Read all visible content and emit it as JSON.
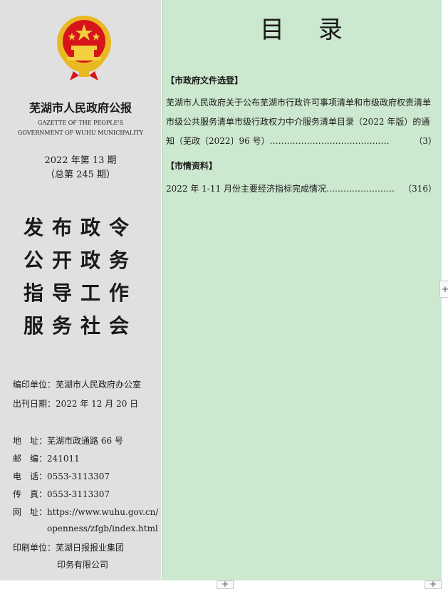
{
  "cover": {
    "title_cn": "芜湖市人民政府公报",
    "title_en_line1": "GAZETTE OF THE PEOPLE'S",
    "title_en_line2": "GOVERNMENT OF WUHU MUNICIPALITY",
    "issue_line1": "2022 年第 13 期",
    "issue_line2": "（总第 245 期）",
    "slogan": [
      "发布政令",
      "公开政务",
      "指导工作",
      "服务社会"
    ],
    "info": {
      "editor": "编印单位：芜湖市人民政府办公室",
      "date": "出刊日期：2022 年 12 月 20 日",
      "address": "地　址：芜湖市政通路 66 号",
      "postcode": "邮　编：241011",
      "tel": "电　话：0553-3113307",
      "fax": "传　真：0553-3113307",
      "web": "网　址：https://www.wuhu.gov.cn/",
      "web2": "openness/zfgb/index.html",
      "printer": "印刷单位：芜湖日报报业集团",
      "printer2": "印务有限公司"
    }
  },
  "toc": {
    "title": "目录",
    "sections": [
      {
        "heading": "【市政府文件选登】",
        "entry_text": "芜湖市人民政府关于公布芜湖市行政许可事项清单和市级政府权责清单市级公共服务清单市级行政权力中介服务清单目录（2022 年版）的通知（芜政〔2022〕96 号）……………………………………",
        "page": "（3）"
      },
      {
        "heading": "【市情资料】",
        "entry_text": "2022 年 1-11 月份主要经济指标完成情况……………………",
        "page": "（316）"
      }
    ]
  },
  "colors": {
    "left_bg": "#e0e0e0",
    "right_bg": "#cce8cf",
    "emblem_red": "#d7141a",
    "emblem_gold": "#e8b923"
  },
  "icons": {
    "emblem": "national-emblem-icon",
    "scroll_right": "plus-icon",
    "scroll_bottom": "plus-icon"
  }
}
